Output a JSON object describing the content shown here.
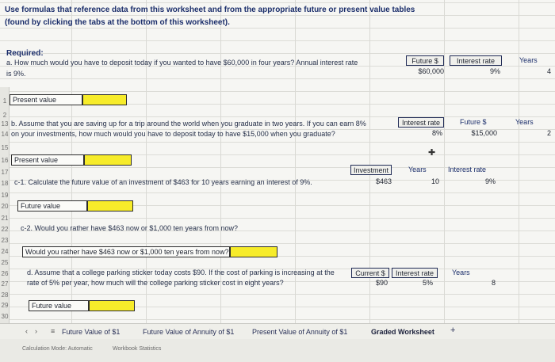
{
  "intro": {
    "line1": "Use formulas that reference data from this worksheet and from the appropriate future or present value tables",
    "line2": "(found by clicking the tabs at the bottom of this worksheet)."
  },
  "required_label": "Required:",
  "q_a": {
    "line1": "a. How much would you have to deposit today if you wanted to have $60,000 in four years? Annual interest rate",
    "line2": "is 9%.",
    "headers": [
      "Future $",
      "Interest rate",
      "Years"
    ],
    "values": [
      "$60,000",
      "9%",
      "4"
    ],
    "answer_label": "Present value"
  },
  "q_b": {
    "line1": "b. Assume that you are saving up for a trip around the world when you graduate in two years. If you can earn 8%",
    "line2": "on your investments, how much would you have to deposit today to have $15,000 when you graduate?",
    "headers": [
      "Interest rate",
      "Future $",
      "Years"
    ],
    "values": [
      "8%",
      "$15,000",
      "2"
    ],
    "answer_label": "Present value"
  },
  "q_c1": {
    "text": "c-1. Calculate the future value of an investment of $463 for 10 years earning an interest of 9%.",
    "headers": [
      "Investment",
      "Years",
      "Interest rate"
    ],
    "values": [
      "$463",
      "10",
      "9%"
    ],
    "answer_label": "Future value"
  },
  "q_c2": {
    "text": "c-2. Would you rather have $463 now or $1,000 ten years from now?",
    "answer_label": "Would you rather have $463 now or $1,000 ten years from now?"
  },
  "q_d": {
    "line1": "d. Assume that a college parking sticker today costs $90. If the cost of parking is increasing at the",
    "line2": "rate of 5% per year, how much will the college parking sticker cost in eight years?",
    "headers": [
      "Current $",
      "Interest rate",
      "Years"
    ],
    "values": [
      "$90",
      "5%",
      "8"
    ],
    "answer_label": "Future value"
  },
  "row_numbers": [
    "1",
    "2",
    "13",
    "14",
    "15",
    "16",
    "17",
    "18",
    "19",
    "20",
    "21",
    "22",
    "23",
    "24",
    "25",
    "26",
    "27",
    "28",
    "29",
    "30"
  ],
  "tabs": [
    "Future Value of $1",
    "Future Value of Annuity of $1",
    "Present Value of Annuity of $1",
    "Graded Worksheet"
  ],
  "tab_add": "+",
  "status": {
    "calc_mode": "Calculation Mode: Automatic",
    "stats": "Workbook Statistics"
  },
  "colors": {
    "input_fill": "#f7ec2a",
    "header_border": "#1f2a55"
  }
}
